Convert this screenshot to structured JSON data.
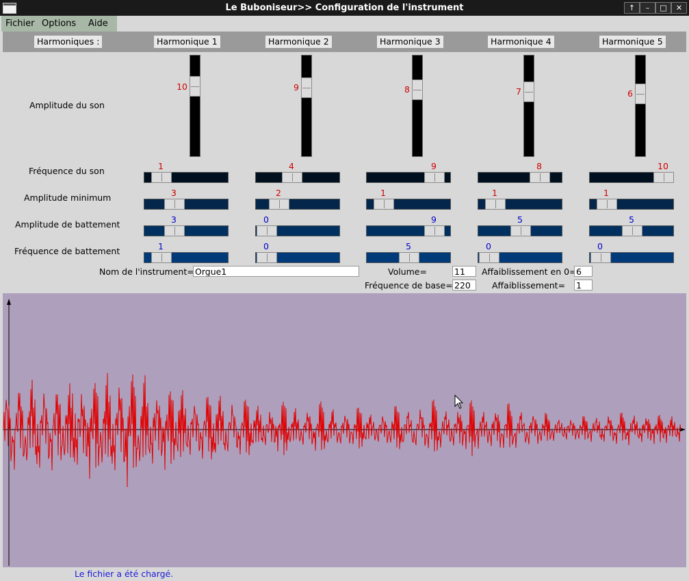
{
  "window": {
    "title": "Le Buboniseur>> Configuration de l'instrument"
  },
  "menu": {
    "fichier": "Fichier",
    "options": "Options",
    "aide": "Aide"
  },
  "header": {
    "label": "Harmoniques :",
    "harmonics": [
      "Harmonique 1",
      "Harmonique 2",
      "Harmonique 3",
      "Harmonique 4",
      "Harmonique 5"
    ]
  },
  "rows": {
    "amplitude_son": "Amplitude du son",
    "frequence_son": "Fréquence du son",
    "amplitude_min": "Amplitude minimum",
    "amplitude_batt": "Amplitude de battement",
    "frequence_batt": "Fréquence de battement"
  },
  "values": {
    "amplitude_son": [
      10,
      9,
      8,
      7,
      6
    ],
    "frequence_son": [
      1,
      4,
      9,
      8,
      10
    ],
    "amplitude_min": [
      3,
      2,
      1,
      1,
      1
    ],
    "amplitude_batt": [
      3,
      0,
      9,
      5,
      5
    ],
    "frequence_batt": [
      1,
      0,
      5,
      0,
      0
    ]
  },
  "fields": {
    "nom_label": "Nom de l'instrument=",
    "nom_value": "Orgue1",
    "volume_label": "Volume=",
    "volume_value": "11",
    "freq_base_label": "Fréquence de base=",
    "freq_base_value": "220",
    "affaib0_label": "Affaiblissement en 0=",
    "affaib0_value": "6",
    "affaib_label": "Affaiblissement=",
    "affaib_value": "1"
  },
  "status": "Le fichier a été chargé.",
  "colors": {
    "plot_bg": "#aea0bc",
    "wave": "#e00000",
    "value_red": "#d00000",
    "value_blue": "#0000cc"
  }
}
